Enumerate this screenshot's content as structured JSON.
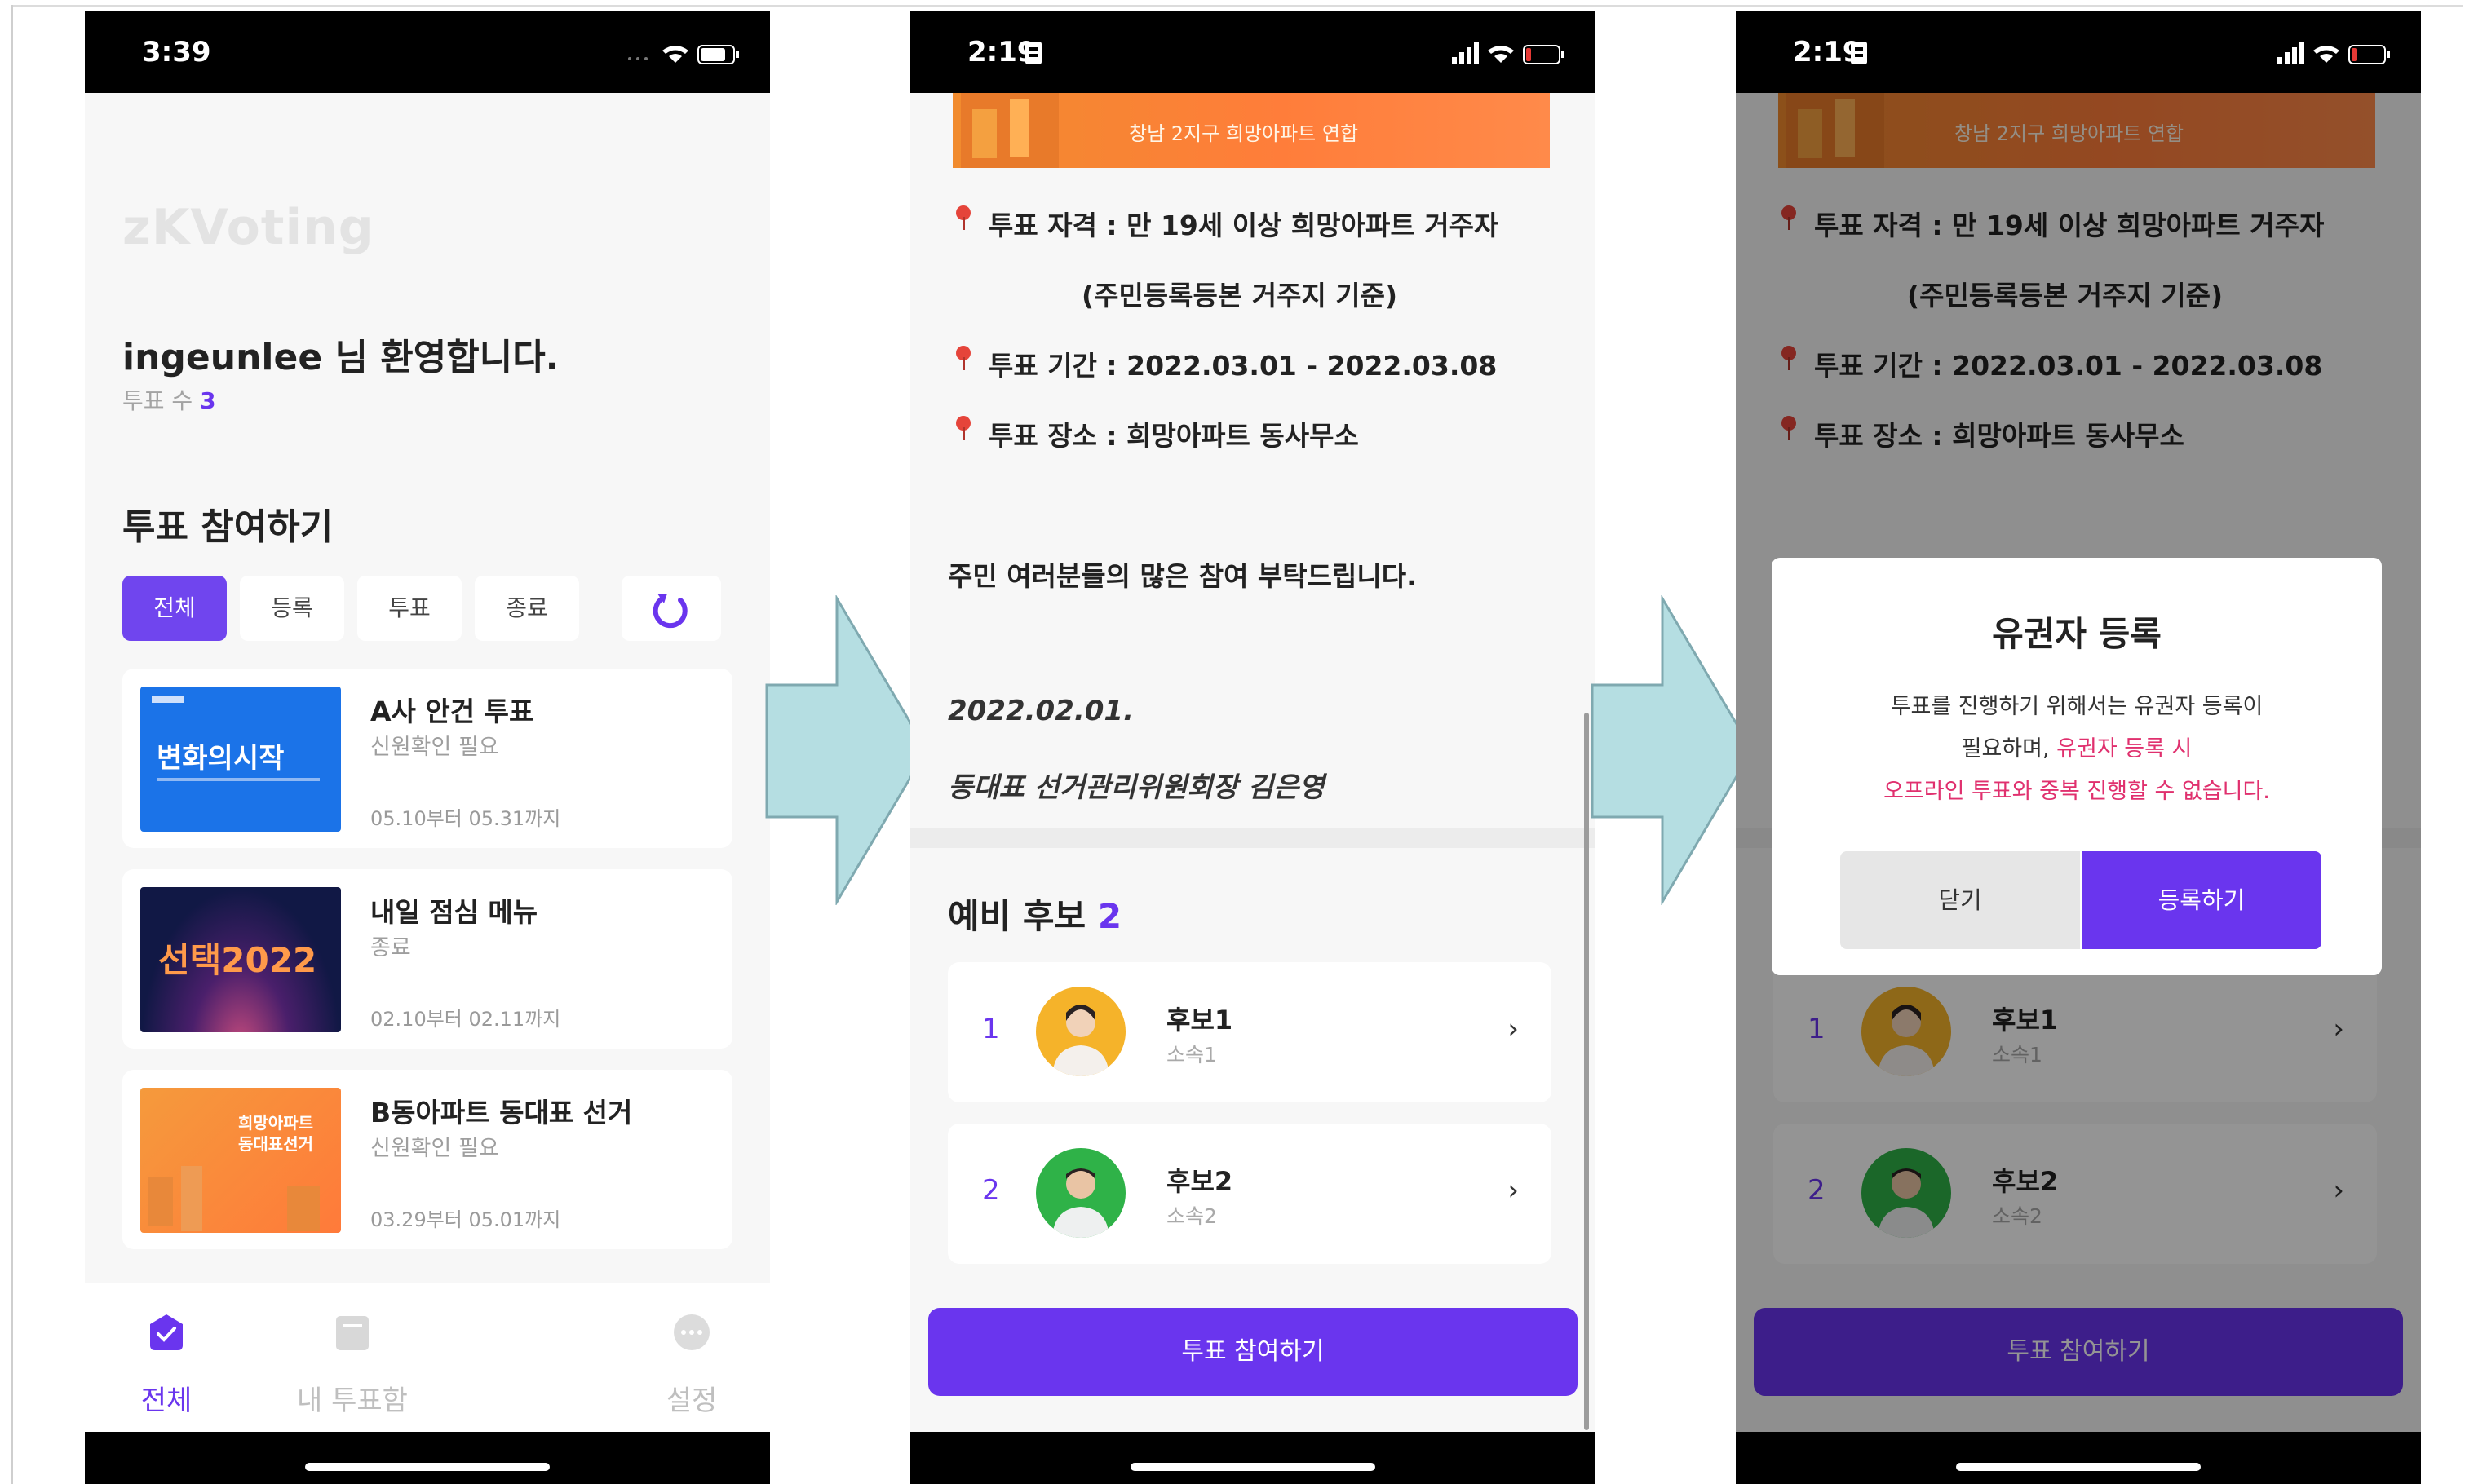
{
  "phone1": {
    "status_time": "3:39",
    "logo": "zKVoting",
    "welcome": "ingeunlee 님 환영합니다.",
    "vote_count_label": "투표 수",
    "vote_count": "3",
    "section_title": "투표 참여하기",
    "filters": [
      "전체",
      "등록",
      "투표",
      "종료"
    ],
    "cards": [
      {
        "title": "A사 안건 투표",
        "subtitle": "신원확인 필요",
        "date": "05.10부터 05.31까지",
        "thumb_text": "변화의시작"
      },
      {
        "title": "내일 점심 메뉴",
        "subtitle": "종료",
        "date": "02.10부터 02.11까지",
        "thumb_text": "선택2022"
      },
      {
        "title": "B동아파트 동대표 선거",
        "subtitle": "신원확인 필요",
        "date": "03.29부터 05.01까지",
        "thumb_text": "희망아파트 동대표선거"
      }
    ],
    "tabs": [
      "전체",
      "내 투표함",
      "설정"
    ]
  },
  "phone2": {
    "status_time": "2:19",
    "banner_text": "창남 2지구 희망아파트 연합",
    "eligibility": "투표 자격 : 만 19세 이상 희망아파트 거주자",
    "eligibility_note": "(주민등록등본 거주지 기준)",
    "period": "투표 기간 : 2022.03.01 - 2022.03.08",
    "place": "투표 장소 : 희망아파트 동사무소",
    "notice": "주민 여러분들의 많은 참여 부탁드립니다.",
    "date": "2022.02.01.",
    "signature": "동대표 선거관리위원회장 김은영",
    "candidates_title": "예비 후보",
    "candidates_count": "2",
    "candidates": [
      {
        "num": "1",
        "name": "후보1",
        "affiliation": "소속1"
      },
      {
        "num": "2",
        "name": "후보2",
        "affiliation": "소속2"
      }
    ],
    "cta": "투표 참여하기"
  },
  "phone3": {
    "status_time": "2:19",
    "modal_title": "유권자 등록",
    "modal_line1": "투표를 진행하기 위해서는 유권자 등록이",
    "modal_line2_a": "필요하며, ",
    "modal_line2_b": "유권자 등록 시",
    "modal_line3": "오프라인 투표와 중복 진행할 수 없습니다.",
    "close_label": "닫기",
    "register_label": "등록하기"
  },
  "colors": {
    "accent": "#6a35ee",
    "warning": "#e0306e",
    "arrow": "#b5dee2"
  }
}
